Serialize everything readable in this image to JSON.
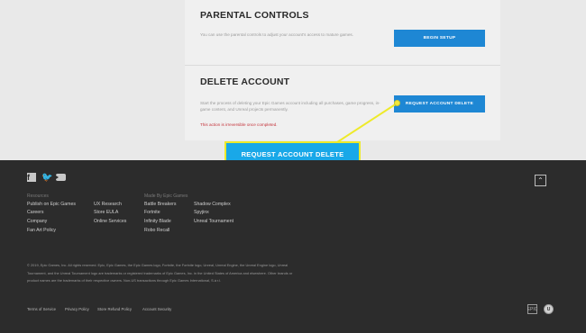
{
  "parental_controls": {
    "title": "PARENTAL CONTROLS",
    "description": "You can use the parental controls to adjust your account's access to mature games.",
    "button": "BEGIN SETUP"
  },
  "delete_account": {
    "title": "DELETE ACCOUNT",
    "description": "Start the process of deleting your Epic Games account including all purchases, game progress, in-game content, and Unreal projects permanently.",
    "warning": "This action is irreversible once completed.",
    "button": "REQUEST ACCOUNT DELETE"
  },
  "callout": {
    "label": "REQUEST ACCOUNT DELETE"
  },
  "footer": {
    "social": {
      "facebook": "f",
      "twitter": "🐦"
    },
    "back_to_top": "⌃",
    "resources_heading": "Resources",
    "resources_col1": [
      "Publish on Epic Games",
      "Careers",
      "Company",
      "Fan Art Policy"
    ],
    "resources_col2": [
      "UX Research",
      "Store EULA",
      "Online Services"
    ],
    "made_by_heading": "Made By Epic Games",
    "made_by_col1": [
      "Battle Breakers",
      "Fortnite",
      "Infinity Blade",
      "Robo Recall"
    ],
    "made_by_col2": [
      "Shadow Complex",
      "Spyjinx",
      "Unreal Tournament"
    ],
    "legal": "© 2019, Epic Games, Inc. All rights reserved. Epic, Epic Games, the Epic Games logo, Fortnite, the Fortnite logo, Unreal, Unreal Engine, the Unreal Engine logo, Unreal Tournament, and the Unreal Tournament logo are trademarks or registered trademarks of Epic Games, Inc. in the United States of America and elsewhere. Other brands or product names are the trademarks of their respective owners. Non-US transactions through Epic Games International, S.à r.l.",
    "bottom_links": [
      "Terms of Service",
      "Privacy Policy",
      "Store Refund Policy",
      "Account Security"
    ],
    "badge_left": "EPIC",
    "badge_right": "U"
  },
  "colors": {
    "accent_blue": "#1e87d4",
    "callout_blue": "#19a8e8",
    "highlight_yellow": "#eeea2a",
    "warning_red": "#c4323a",
    "footer_bg": "#2c2c2c"
  }
}
